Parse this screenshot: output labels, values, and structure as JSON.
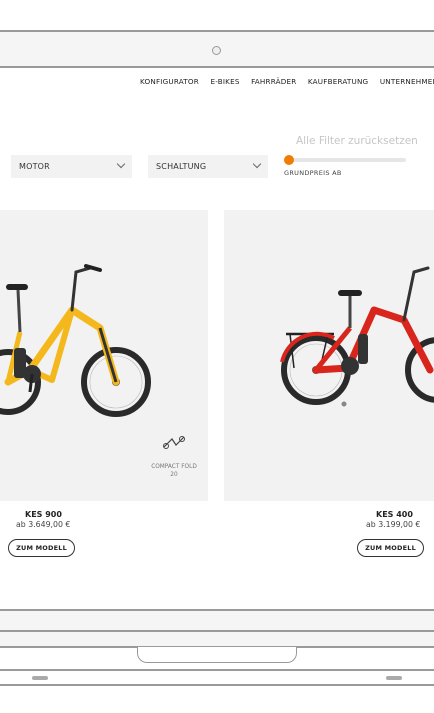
{
  "nav": {
    "items": [
      "KONFIGURATOR",
      "E-BIKES",
      "FAHRRÄDER",
      "KAUFBERATUNG",
      "UNTERNEHMEN"
    ]
  },
  "filters": {
    "reset_label": "Alle Filter zurücksetzen",
    "motor_label": "MOTOR",
    "schaltung_label": "SCHALTUNG",
    "price_label": "GRUNDPREIS AB",
    "price_slider_position": 0
  },
  "products": [
    {
      "name": "KES 900",
      "price": "ab 3.649,00 €",
      "button": "ZUM MODELL",
      "badge_line1": "COMPACT FOLD",
      "badge_line2": "20",
      "frame_color": "#f4b81c"
    },
    {
      "name": "KES 400",
      "price": "ab 3.199,00 €",
      "button": "ZUM MODELL",
      "frame_color": "#d9261c"
    }
  ],
  "colors": {
    "accent": "#f07c00",
    "card_bg": "#f2f2f2"
  }
}
